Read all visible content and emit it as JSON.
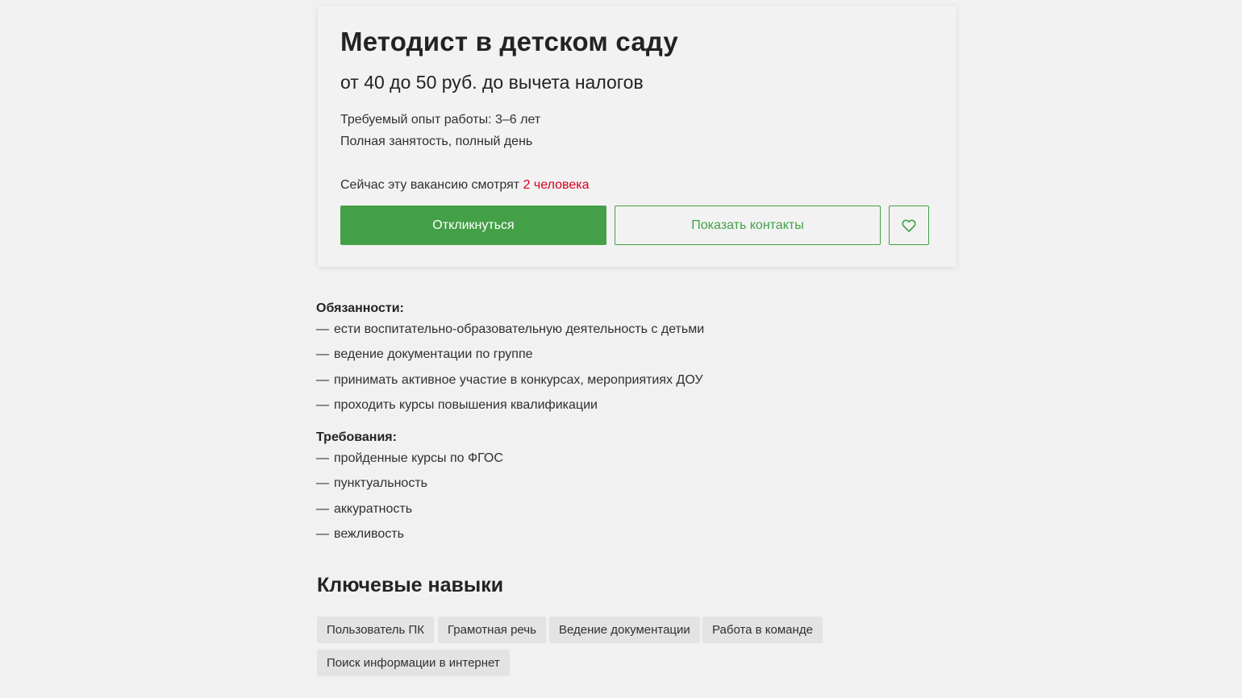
{
  "vacancy": {
    "title": "Методист в детском саду",
    "salary": "от 40 до 50 руб. до вычета налогов",
    "experience": "Требуемый опыт работы: 3–6 лет",
    "employment": "Полная занятость, полный день",
    "viewers_prefix": "Сейчас эту вакансию смотрят ",
    "viewers_count": "2 человека",
    "respond_label": "Откликнуться",
    "contacts_label": "Показать контакты",
    "favorite_icon": "heart-icon"
  },
  "description": {
    "duties_heading": "Обязанности:",
    "duties": [
      "ести воспитательно-образовательную деятельность с детьми",
      "ведение документации по группе",
      "принимать активное участие в конкурсах, мероприятиях ДОУ",
      "проходить курсы повышения квалификации"
    ],
    "requirements_heading": "Требования:",
    "requirements": [
      "пройденные курсы по ФГОС",
      "пунктуальность",
      "аккуратность",
      "вежливость"
    ],
    "dash": "—"
  },
  "skills": {
    "heading": "Ключевые навыки",
    "tags": [
      "Пользователь ПК",
      "Грамотная речь",
      "Ведение документации",
      "Работа в команде",
      "Поиск информации в интернет"
    ]
  },
  "colors": {
    "accent_green": "#43a047",
    "viewers_red": "#d6001c",
    "tag_bg": "#e3e3e3"
  }
}
